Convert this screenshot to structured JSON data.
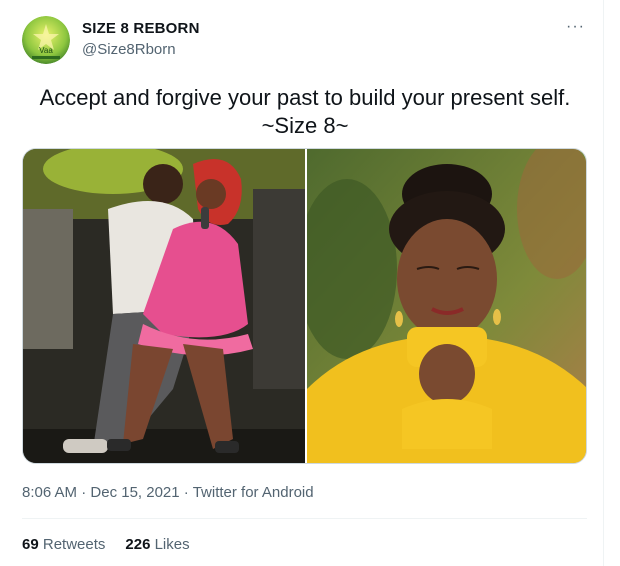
{
  "author": {
    "display_name": "SIZE 8 REBORN",
    "handle": "@Size8Rborn",
    "avatar_text": "Vaa"
  },
  "tweet": {
    "line1": "Accept and forgive your past to build your present self.",
    "line2": "~Size 8~"
  },
  "meta": {
    "time": "8:06 AM",
    "sep1": "·",
    "date": "Dec 15, 2021",
    "sep2": "·",
    "source": "Twitter for Android"
  },
  "stats": {
    "retweets_count": "69",
    "retweets_label": "Retweets",
    "likes_count": "226",
    "likes_label": "Likes"
  },
  "more_label": "···",
  "colors": {
    "secondary_text": "#536471",
    "primary_text": "#0f1419",
    "border": "#cfd9de",
    "avatar_green": "#8dc63f"
  }
}
